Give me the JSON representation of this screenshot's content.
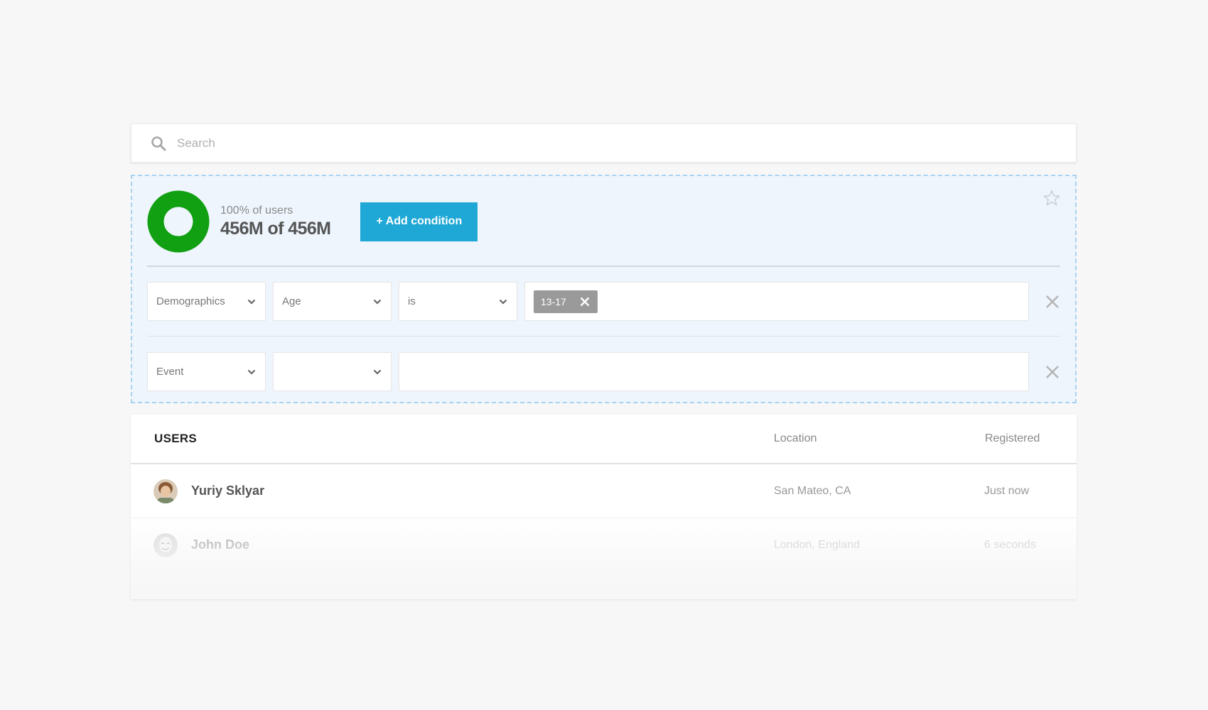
{
  "search": {
    "placeholder": "Search"
  },
  "segment": {
    "percent_label": "100% of users",
    "count_label": "456M of 456M",
    "coverage_fraction": 1.0,
    "add_condition_label": "+ Add condition",
    "conditions": [
      {
        "category": "Demographics",
        "field": "Age",
        "operator": "is",
        "values": [
          "13-17"
        ]
      },
      {
        "category": "Event",
        "field": "",
        "operator": null,
        "values": []
      }
    ]
  },
  "users": {
    "header": {
      "title": "USERS",
      "location": "Location",
      "registered": "Registered"
    },
    "rows": [
      {
        "name": "Yuriy Sklyar",
        "location": "San Mateo, CA",
        "registered": "Just now"
      },
      {
        "name": "John Doe",
        "location": "London, England",
        "registered": "6 seconds"
      }
    ]
  },
  "colors": {
    "accent": "#1fa8d6",
    "donut": "#11a011",
    "segment_bg": "#eef5fd",
    "segment_border": "#a9d2f0",
    "tag": "#9a9a9a"
  }
}
